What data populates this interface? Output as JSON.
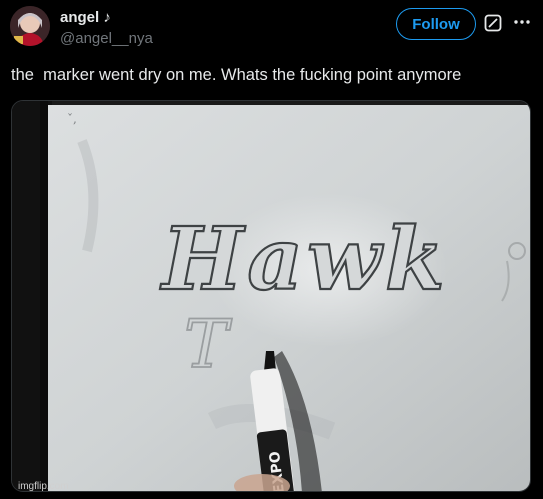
{
  "post": {
    "display_name": "angel ♪",
    "handle": "@angel__nya",
    "follow_label": "Follow",
    "text": "the  marker went dry on me. Whats the fucking point anymore"
  },
  "media": {
    "board_word": "Hawk",
    "board_letter": "T",
    "marker_brand": "EXPO"
  },
  "watermark": "imgflip.com",
  "colors": {
    "background": "#000000",
    "text": "#e7e9ea",
    "secondary_text": "#71767b",
    "accent": "#1d9bf0"
  },
  "icons": {
    "grok": "grok-icon",
    "more": "more-icon"
  }
}
